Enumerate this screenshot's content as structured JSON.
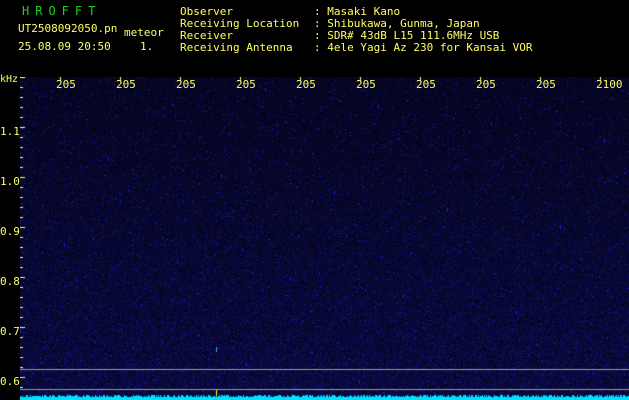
{
  "header": {
    "app_title": "HROFFT",
    "filename": "UT2508092050.pn",
    "mode": "meteor",
    "datetime": "25.08.09 20:50",
    "value": "1.",
    "info": [
      {
        "label": "Observer",
        "value": ": Masaki Kano"
      },
      {
        "label": "Receiving Location",
        "value": ": Shibukawa, Gunma, Japan"
      },
      {
        "label": "Receiver",
        "value": ": SDR# 43dB L15 111.6MHz USB"
      },
      {
        "label": "Receiving Antenna",
        "value": ": 4ele Yagi Az 230 for Kansai VOR"
      }
    ]
  },
  "axes": {
    "y_unit": "kHz",
    "x_ticks": [
      "205",
      "205",
      "205",
      "205",
      "205",
      "205",
      "205",
      "205",
      "205",
      "2100"
    ],
    "y_ticks": [
      "1.1",
      "1.0",
      "0.9",
      "0.8",
      "0.7",
      "0.6"
    ]
  },
  "colors": {
    "title": "#1fd11f",
    "text": "#ffff66",
    "background": "#000000",
    "noise": "#1a1a9a",
    "baseline": "#00e0ff",
    "marker": "#ffff00"
  }
}
